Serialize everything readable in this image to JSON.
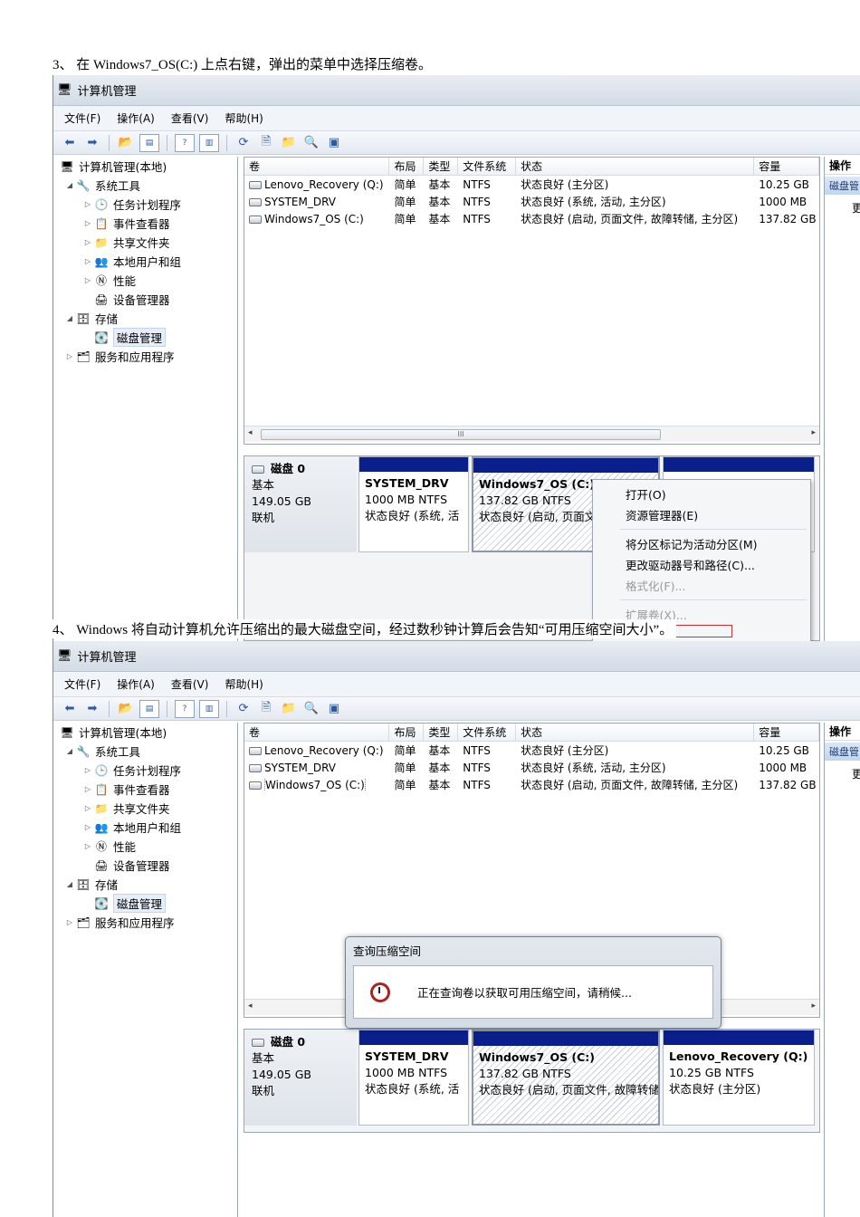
{
  "steps": {
    "step3": "3、 在 Windows7_OS(C:) 上点右键，弹出的菜单中选择压缩卷。",
    "step4": "4、 Windows 将自动计算机允许压缩出的最大磁盘空间，经过数秒钟计算后会告知“可用压缩空间大小”。"
  },
  "window": {
    "title": "计算机管理",
    "menu": [
      "文件(F)",
      "操作(A)",
      "查看(V)",
      "帮助(H)"
    ]
  },
  "tree": {
    "root": "计算机管理(本地)",
    "system_tools": "系统工具",
    "task_scheduler": "任务计划程序",
    "event_viewer": "事件查看器",
    "shared_folders": "共享文件夹",
    "local_users": "本地用户和组",
    "performance": "性能",
    "device_manager": "设备管理器",
    "storage": "存储",
    "disk_management": "磁盘管理",
    "services_apps": "服务和应用程序"
  },
  "volume_table": {
    "headers": [
      "卷",
      "布局",
      "类型",
      "文件系统",
      "状态",
      "容量"
    ],
    "rows": [
      [
        "Lenovo_Recovery (Q:)",
        "简单",
        "基本",
        "NTFS",
        "状态良好 (主分区)",
        "10.25 GB"
      ],
      [
        "SYSTEM_DRV",
        "简单",
        "基本",
        "NTFS",
        "状态良好 (系统, 活动, 主分区)",
        "1000 MB"
      ],
      [
        "Windows7_OS (C:)",
        "简单",
        "基本",
        "NTFS",
        "状态良好 (启动, 页面文件, 故障转储, 主分区)",
        "137.82 GB"
      ]
    ]
  },
  "disk": {
    "name": "磁盘 0",
    "type": "基本",
    "size": "149.05 GB",
    "status": "联机",
    "partitions": [
      {
        "name": "SYSTEM_DRV",
        "size": "1000 MB NTFS",
        "status": "状态良好 (系统, 活"
      },
      {
        "name": "Windows7_OS  (C:)",
        "size": "137.82 GB NTFS",
        "status": "状态良好 (启动, 页面文",
        "status_full": "状态良好 (启动, 页面文件, 故障转储"
      },
      {
        "name": "Lenovo_Recovery  (Q:)",
        "size": "10.25 GB NTFS",
        "status": "状态良好 (主分区)"
      }
    ]
  },
  "ops_panel": {
    "title": "操作",
    "item": "磁盘管",
    "more": "更"
  },
  "context_menu": {
    "items": [
      "打开(O)",
      "资源管理器(E)",
      "将分区标记为活动分区(M)",
      "更改驱动器号和路径(C)...",
      "格式化(F)...",
      "扩展卷(X)..."
    ]
  },
  "dialog": {
    "title": "查询压缩空间",
    "message": "正在查询卷以获取可用压缩空间，请稍候..."
  }
}
